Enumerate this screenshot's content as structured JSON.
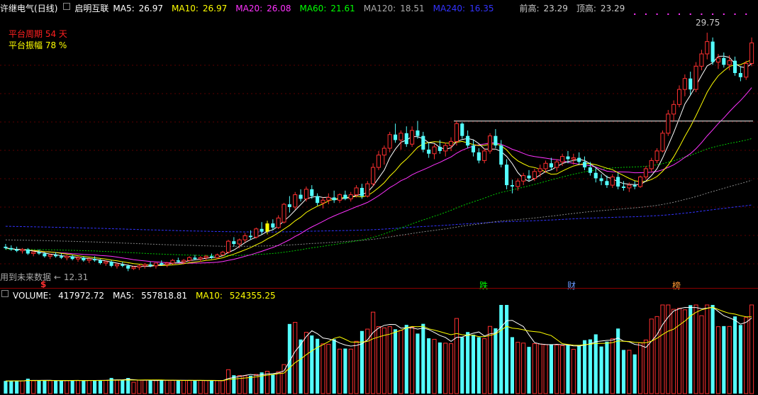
{
  "header": {
    "stock_name": "许继电气",
    "period": "(日线)",
    "indicator_name": "启明互联",
    "ma5": {
      "label": "MA5:",
      "value": "26.97",
      "color": "#ffffff"
    },
    "ma10": {
      "label": "MA10:",
      "value": "26.97",
      "color": "#ffff00"
    },
    "ma20": {
      "label": "MA20:",
      "value": "26.08",
      "color": "#ff33ff"
    },
    "ma60": {
      "label": "MA60:",
      "value": "21.61",
      "color": "#00ff00"
    },
    "ma120": {
      "label": "MA120:",
      "value": "18.51",
      "color": "#aaaaaa"
    },
    "ma240": {
      "label": "MA240:",
      "value": "16.35",
      "color": "#3333ff"
    },
    "prev_high": {
      "label": "前高:",
      "value": "23.29"
    },
    "top_high": {
      "label": "顶高:",
      "value": "23.29"
    }
  },
  "platform": {
    "period_label": "平台周期",
    "period_value": "54 天",
    "amp_label": "平台振幅",
    "amp_value": "78 %"
  },
  "annotations": {
    "max_label": "29.75",
    "min_label": "12.31",
    "future_data_note": "用到未来数据",
    "marker_s": "$",
    "marker_die": "跌",
    "marker_cai": "财",
    "marker_bang": "榜"
  },
  "volume_header": {
    "name": "VOLUME:",
    "value": "417972.72",
    "ma5_label": "MA5:",
    "ma5_value": "557818.81",
    "ma10_label": "MA10:",
    "ma10_value": "524355.25"
  },
  "chart_data": {
    "type": "candlestick",
    "price_range": [
      11.5,
      31.0
    ],
    "candles": [
      [
        14.1,
        14.3,
        13.9,
        14.0
      ],
      [
        14.0,
        14.2,
        13.8,
        13.9
      ],
      [
        13.9,
        14.1,
        13.7,
        13.8
      ],
      [
        13.8,
        14.0,
        13.6,
        13.9
      ],
      [
        13.9,
        14.0,
        13.5,
        13.6
      ],
      [
        13.6,
        13.8,
        13.4,
        13.7
      ],
      [
        13.7,
        13.9,
        13.5,
        13.6
      ],
      [
        13.6,
        13.7,
        13.3,
        13.4
      ],
      [
        13.4,
        13.6,
        13.2,
        13.5
      ],
      [
        13.5,
        13.7,
        13.3,
        13.4
      ],
      [
        13.4,
        13.6,
        13.2,
        13.3
      ],
      [
        13.3,
        13.5,
        13.1,
        13.4
      ],
      [
        13.4,
        13.5,
        13.1,
        13.2
      ],
      [
        13.2,
        13.4,
        13.0,
        13.3
      ],
      [
        13.3,
        13.4,
        13.0,
        13.1
      ],
      [
        13.1,
        13.3,
        12.9,
        13.2
      ],
      [
        13.2,
        13.4,
        13.0,
        13.1
      ],
      [
        13.1,
        13.2,
        12.8,
        12.9
      ],
      [
        12.9,
        13.1,
        12.7,
        13.0
      ],
      [
        13.0,
        13.1,
        12.6,
        12.7
      ],
      [
        12.7,
        12.9,
        12.5,
        12.8
      ],
      [
        12.8,
        13.0,
        12.6,
        12.7
      ],
      [
        12.7,
        12.8,
        12.31,
        12.5
      ],
      [
        12.5,
        12.7,
        12.4,
        12.6
      ],
      [
        12.6,
        12.8,
        12.4,
        12.7
      ],
      [
        12.7,
        12.9,
        12.5,
        12.8
      ],
      [
        12.8,
        13.0,
        12.6,
        12.7
      ],
      [
        12.7,
        12.9,
        12.5,
        12.9
      ],
      [
        12.9,
        13.1,
        12.7,
        12.8
      ],
      [
        12.8,
        13.0,
        12.6,
        12.9
      ],
      [
        12.9,
        13.2,
        12.8,
        13.1
      ],
      [
        13.1,
        13.3,
        12.9,
        13.0
      ],
      [
        13.0,
        13.2,
        12.8,
        13.1
      ],
      [
        13.1,
        13.4,
        13.0,
        13.3
      ],
      [
        13.3,
        13.5,
        13.1,
        13.2
      ],
      [
        13.2,
        13.4,
        13.0,
        13.3
      ],
      [
        13.3,
        13.5,
        13.1,
        13.4
      ],
      [
        13.4,
        13.6,
        13.2,
        13.3
      ],
      [
        13.3,
        13.6,
        13.2,
        13.5
      ],
      [
        13.5,
        13.8,
        13.4,
        13.7
      ],
      [
        13.7,
        14.6,
        13.6,
        14.5
      ],
      [
        14.5,
        14.8,
        14.1,
        14.3
      ],
      [
        14.3,
        14.7,
        14.0,
        14.6
      ],
      [
        14.6,
        15.1,
        14.4,
        14.9
      ],
      [
        14.9,
        15.3,
        14.6,
        14.8
      ],
      [
        14.8,
        15.5,
        14.7,
        15.4
      ],
      [
        15.4,
        15.9,
        15.0,
        15.2
      ],
      [
        15.2,
        16.0,
        15.0,
        15.8
      ],
      [
        15.8,
        16.1,
        15.3,
        15.5
      ],
      [
        15.5,
        16.4,
        15.4,
        16.2
      ],
      [
        15.9,
        17.3,
        15.8,
        17.2
      ],
      [
        17.2,
        17.8,
        16.6,
        17.0
      ],
      [
        17.0,
        18.1,
        16.8,
        17.9
      ],
      [
        17.9,
        18.3,
        17.4,
        17.6
      ],
      [
        17.6,
        18.5,
        17.4,
        18.3
      ],
      [
        18.3,
        18.6,
        17.6,
        17.8
      ],
      [
        17.8,
        18.0,
        17.1,
        17.3
      ],
      [
        17.3,
        17.7,
        16.9,
        17.5
      ],
      [
        17.5,
        18.0,
        17.2,
        17.7
      ],
      [
        17.7,
        18.2,
        17.3,
        17.5
      ],
      [
        17.5,
        18.0,
        17.3,
        17.9
      ],
      [
        17.9,
        18.2,
        17.5,
        17.6
      ],
      [
        17.6,
        18.1,
        17.4,
        17.9
      ],
      [
        17.9,
        18.6,
        17.7,
        18.4
      ],
      [
        18.4,
        18.7,
        17.6,
        17.8
      ],
      [
        17.8,
        18.9,
        17.7,
        18.7
      ],
      [
        18.7,
        20.2,
        18.5,
        19.9
      ],
      [
        19.9,
        21.1,
        19.7,
        20.8
      ],
      [
        20.8,
        21.5,
        20.1,
        21.3
      ],
      [
        21.3,
        22.5,
        21.0,
        22.3
      ],
      [
        22.3,
        23.1,
        21.7,
        21.9
      ],
      [
        21.9,
        22.6,
        21.2,
        22.4
      ],
      [
        22.4,
        22.9,
        21.4,
        21.6
      ],
      [
        21.6,
        22.9,
        21.4,
        22.6
      ],
      [
        22.6,
        23.3,
        22.0,
        22.2
      ],
      [
        22.2,
        22.5,
        21.0,
        21.2
      ],
      [
        21.2,
        21.7,
        20.6,
        20.9
      ],
      [
        20.9,
        21.6,
        20.5,
        21.4
      ],
      [
        21.4,
        21.9,
        20.9,
        21.1
      ],
      [
        21.1,
        21.7,
        20.7,
        21.5
      ],
      [
        21.5,
        22.1,
        21.1,
        21.8
      ],
      [
        21.8,
        23.29,
        21.5,
        23.1
      ],
      [
        23.1,
        23.2,
        22.0,
        22.2
      ],
      [
        22.2,
        22.6,
        21.3,
        21.5
      ],
      [
        21.5,
        21.9,
        20.7,
        21.0
      ],
      [
        21.0,
        21.3,
        20.2,
        20.4
      ],
      [
        20.4,
        21.3,
        20.2,
        21.1
      ],
      [
        21.1,
        22.4,
        20.9,
        22.2
      ],
      [
        22.2,
        22.7,
        21.3,
        21.5
      ],
      [
        21.5,
        21.9,
        19.9,
        20.1
      ],
      [
        20.1,
        20.5,
        18.3,
        18.6
      ],
      [
        18.6,
        19.0,
        18.0,
        18.5
      ],
      [
        18.5,
        19.1,
        18.2,
        18.9
      ],
      [
        18.9,
        19.5,
        18.6,
        19.3
      ],
      [
        19.3,
        19.7,
        18.9,
        19.1
      ],
      [
        19.1,
        19.8,
        18.9,
        19.6
      ],
      [
        19.6,
        20.1,
        19.2,
        19.8
      ],
      [
        19.8,
        20.4,
        19.5,
        20.2
      ],
      [
        20.2,
        20.6,
        19.7,
        19.9
      ],
      [
        19.9,
        20.5,
        19.6,
        20.3
      ],
      [
        20.3,
        20.9,
        20.0,
        20.7
      ],
      [
        20.7,
        21.1,
        20.2,
        20.5
      ],
      [
        20.5,
        20.9,
        20.1,
        20.6
      ],
      [
        20.6,
        21.0,
        20.1,
        20.3
      ],
      [
        20.3,
        20.7,
        19.7,
        19.9
      ],
      [
        19.9,
        20.3,
        19.3,
        19.5
      ],
      [
        19.5,
        19.9,
        18.8,
        19.1
      ],
      [
        19.1,
        19.4,
        18.6,
        18.9
      ],
      [
        18.9,
        19.3,
        18.4,
        18.6
      ],
      [
        18.6,
        19.4,
        18.4,
        19.2
      ],
      [
        19.2,
        19.5,
        18.3,
        18.5
      ],
      [
        18.5,
        18.9,
        18.2,
        18.4
      ],
      [
        18.4,
        18.8,
        18.1,
        18.6
      ],
      [
        18.6,
        18.9,
        18.3,
        18.5
      ],
      [
        18.5,
        19.3,
        18.4,
        19.2
      ],
      [
        19.2,
        20.0,
        19.0,
        19.8
      ],
      [
        19.8,
        20.6,
        19.6,
        20.4
      ],
      [
        20.4,
        21.3,
        20.2,
        21.1
      ],
      [
        21.1,
        22.6,
        21.0,
        22.4
      ],
      [
        22.4,
        24.1,
        22.2,
        23.8
      ],
      [
        23.8,
        24.8,
        23.3,
        24.5
      ],
      [
        24.5,
        25.9,
        24.3,
        25.6
      ],
      [
        25.6,
        26.7,
        25.1,
        26.4
      ],
      [
        26.4,
        26.9,
        25.2,
        25.6
      ],
      [
        25.6,
        27.6,
        25.4,
        27.3
      ],
      [
        27.3,
        28.5,
        27.0,
        28.2
      ],
      [
        28.2,
        29.75,
        27.8,
        29.1
      ],
      [
        29.1,
        29.4,
        27.4,
        27.6
      ],
      [
        27.6,
        28.2,
        27.1,
        27.9
      ],
      [
        27.9,
        28.3,
        27.2,
        27.4
      ],
      [
        27.4,
        28.1,
        27.0,
        27.7
      ],
      [
        27.7,
        28.0,
        26.6,
        26.8
      ],
      [
        26.8,
        27.3,
        26.2,
        26.5
      ],
      [
        26.5,
        27.7,
        26.3,
        27.5
      ],
      [
        27.5,
        29.4,
        27.3,
        29.0
      ]
    ]
  }
}
